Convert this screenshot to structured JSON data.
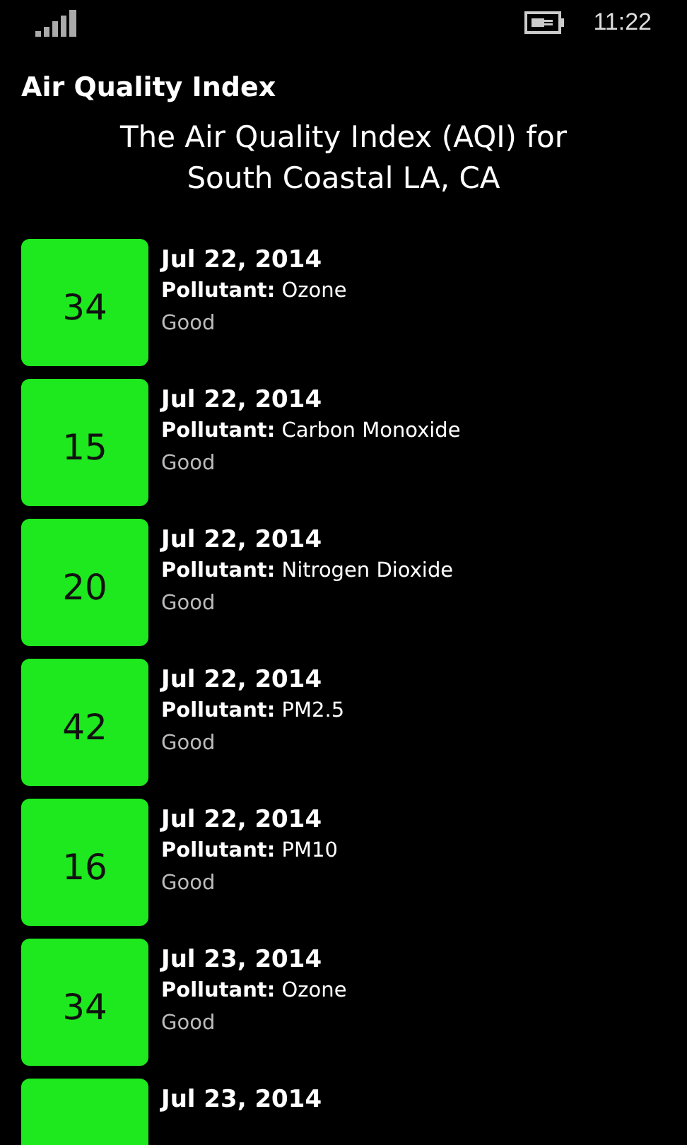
{
  "status_bar": {
    "time": "11:22"
  },
  "title": "Air Quality Index",
  "subtitle": "The Air Quality Index (AQI) for South Coastal LA, CA",
  "readings": [
    {
      "aqi": "34",
      "date": "Jul 22, 2014",
      "pollutant_label": "Pollutant:",
      "pollutant": "Ozone",
      "category": "Good"
    },
    {
      "aqi": "15",
      "date": "Jul 22, 2014",
      "pollutant_label": "Pollutant:",
      "pollutant": "Carbon Monoxide",
      "category": "Good"
    },
    {
      "aqi": "20",
      "date": "Jul 22, 2014",
      "pollutant_label": "Pollutant:",
      "pollutant": "Nitrogen Dioxide",
      "category": "Good"
    },
    {
      "aqi": "42",
      "date": "Jul 22, 2014",
      "pollutant_label": "Pollutant:",
      "pollutant": "PM2.5",
      "category": "Good"
    },
    {
      "aqi": "16",
      "date": "Jul 22, 2014",
      "pollutant_label": "Pollutant:",
      "pollutant": "PM10",
      "category": "Good"
    },
    {
      "aqi": "34",
      "date": "Jul 23, 2014",
      "pollutant_label": "Pollutant:",
      "pollutant": "Ozone",
      "category": "Good"
    },
    {
      "date": "Jul 23, 2014"
    }
  ]
}
